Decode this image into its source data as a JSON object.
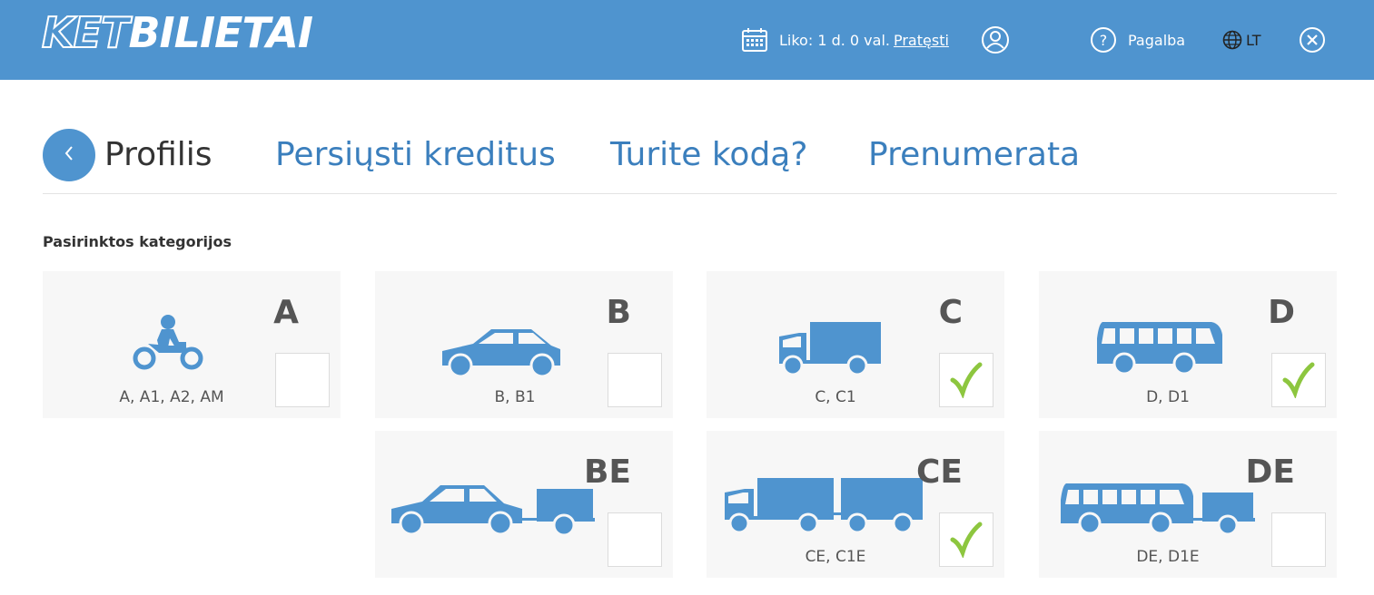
{
  "header": {
    "logo_part1": "KET",
    "logo_part2": "BILIETAI",
    "subscription_text": "Liko: 1 d. 0 val.",
    "extend_link": "Pratęsti",
    "help_label": "Pagalba",
    "language": "LT"
  },
  "nav": {
    "title": "Profilis",
    "links": [
      "Persiųsti kreditus",
      "Turite kodą?",
      "Prenumerata"
    ]
  },
  "section_title": "Pasirinktos kategorijos",
  "categories": [
    {
      "code": "A",
      "subtitle": "A, A1, A2, AM",
      "vehicle": "motorcycle-icon",
      "checked": false
    },
    {
      "code": "B",
      "subtitle": "B, B1",
      "vehicle": "car-icon",
      "checked": false
    },
    {
      "code": "C",
      "subtitle": "C, C1",
      "vehicle": "truck-icon",
      "checked": true
    },
    {
      "code": "D",
      "subtitle": "D, D1",
      "vehicle": "bus-icon",
      "checked": true
    },
    {
      "code": "BE",
      "subtitle": "",
      "vehicle": "car-trailer-icon",
      "checked": false
    },
    {
      "code": "CE",
      "subtitle": "CE, C1E",
      "vehicle": "truck-trailer-icon",
      "checked": true
    },
    {
      "code": "DE",
      "subtitle": "DE, D1E",
      "vehicle": "bus-trailer-icon",
      "checked": false
    }
  ],
  "colors": {
    "brand": "#4f94cf",
    "check": "#8dc63f"
  }
}
